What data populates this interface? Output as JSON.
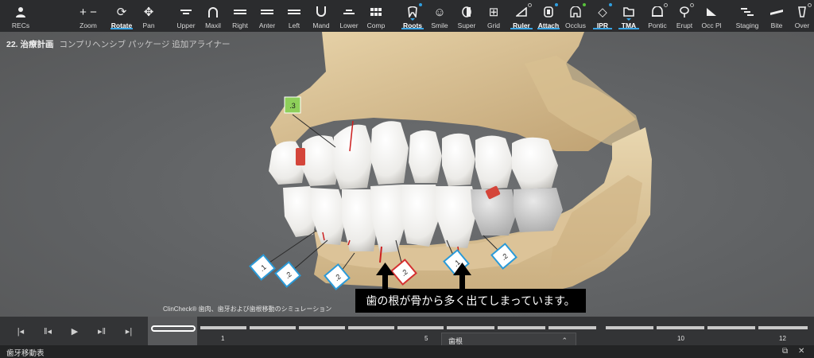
{
  "toolbar": {
    "items": [
      {
        "label": "RECs",
        "icon": "person-icon"
      },
      {
        "label": "Zoom",
        "icon": "zoom-icon"
      },
      {
        "label": "Rotate",
        "icon": "rotate-icon",
        "active": true
      },
      {
        "label": "Pan",
        "icon": "pan-icon"
      },
      {
        "label": "Upper",
        "icon": "upper-jaw-icon"
      },
      {
        "label": "Maxil",
        "icon": "maxilla-icon"
      },
      {
        "label": "Right",
        "icon": "right-view-icon"
      },
      {
        "label": "Anter",
        "icon": "anterior-view-icon"
      },
      {
        "label": "Left",
        "icon": "left-view-icon"
      },
      {
        "label": "Mand",
        "icon": "mandible-icon"
      },
      {
        "label": "Lower",
        "icon": "lower-jaw-icon"
      },
      {
        "label": "Comp",
        "icon": "compare-grid-icon"
      },
      {
        "label": "Roots",
        "icon": "tooth-roots-icon",
        "active": true
      },
      {
        "label": "Smile",
        "icon": "smile-icon"
      },
      {
        "label": "Super",
        "icon": "superimpose-icon"
      },
      {
        "label": "Grid",
        "icon": "grid-icon"
      },
      {
        "label": "Ruler",
        "icon": "ruler-icon",
        "active": true
      },
      {
        "label": "Attach",
        "icon": "attachment-icon",
        "active": true
      },
      {
        "label": "Occlus",
        "icon": "occlusion-icon"
      },
      {
        "label": "IPR",
        "icon": "ipr-diamond-icon",
        "active": true
      },
      {
        "label": "TMA",
        "icon": "tma-folder-icon",
        "active": true
      },
      {
        "label": "Pontic",
        "icon": "pontic-icon"
      },
      {
        "label": "Erupt",
        "icon": "erupt-icon"
      },
      {
        "label": "Occ Pl",
        "icon": "occlusal-plane-icon"
      },
      {
        "label": "Staging",
        "icon": "staging-icon"
      },
      {
        "label": "Bite",
        "icon": "bite-icon"
      },
      {
        "label": "Over",
        "icon": "overjet-icon"
      }
    ]
  },
  "plan": {
    "number": "22. 治療計画",
    "name": "コンプリヘンシブ パッケージ 追加アライナー"
  },
  "viewport": {
    "ipr_labels": {
      "top": ".3",
      "l1": ".1",
      "l2": ".2",
      "l3": ".2",
      "red": ".2",
      "r1": ".1",
      "r2": ".2"
    },
    "callout": "歯の根が骨から多く出てしまっています。",
    "disclaimer": "ClinCheck® 歯肉、歯牙および歯根移動のシミュレーション"
  },
  "staging": {
    "numbers": [
      "1",
      "5",
      "10",
      "12"
    ]
  },
  "dropdown": {
    "value": "歯根"
  },
  "footer": {
    "title": "歯牙移動表"
  }
}
